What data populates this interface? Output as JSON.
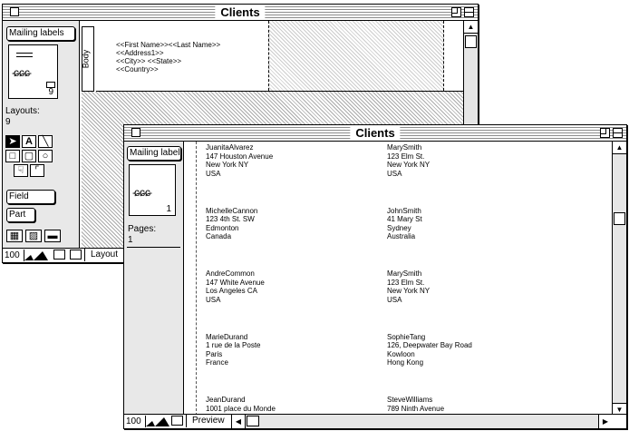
{
  "layout_window": {
    "title": "Clients",
    "layout_menu_label": "Mailing labels",
    "book_page_number": "9",
    "count_label": "Layouts:",
    "count_value": "9",
    "body_part_label": "Body",
    "fields": [
      "<<First Name>><<Last Name>>",
      "<<Address1>>",
      "<<City>> <<State>>",
      "<<Country>>"
    ],
    "field_button_label": "Field",
    "part_button_label": "Part",
    "zoom_level": "100",
    "mode_label": "Layout"
  },
  "preview_window": {
    "title": "Clients",
    "layout_menu_label": "Mailing labels",
    "book_page_number": "1",
    "count_label": "Pages:",
    "count_value": "1",
    "zoom_level": "100",
    "mode_label": "Preview",
    "labels": [
      [
        "JuanitaAlvarez",
        "147 Houston Avenue",
        "New York  NY",
        "USA"
      ],
      [
        "MarySmith",
        "123 Elm St.",
        "New York  NY",
        "USA"
      ],
      [
        "MichelleCannon",
        "123 4th St. SW",
        "Edmonton",
        "Canada"
      ],
      [
        "JohnSmith",
        "41 Mary St",
        "Sydney",
        "Australia"
      ],
      [
        "AndreCommon",
        "147 White Avenue",
        "Los Angeles  CA",
        "USA"
      ],
      [
        "MarySmith",
        "123 Elm St.",
        "New York  NY",
        "USA"
      ],
      [
        "MarieDurand",
        "1 rue de la Poste",
        "Paris",
        "France"
      ],
      [
        "SophieTang",
        "126, Deepwater Bay Road",
        "Kowloon",
        "Hong Kong"
      ],
      [
        "JeanDurand",
        "1001 place du Monde"
      ],
      [
        "SteveWilliams",
        "789 Ninth Avenue"
      ]
    ]
  }
}
